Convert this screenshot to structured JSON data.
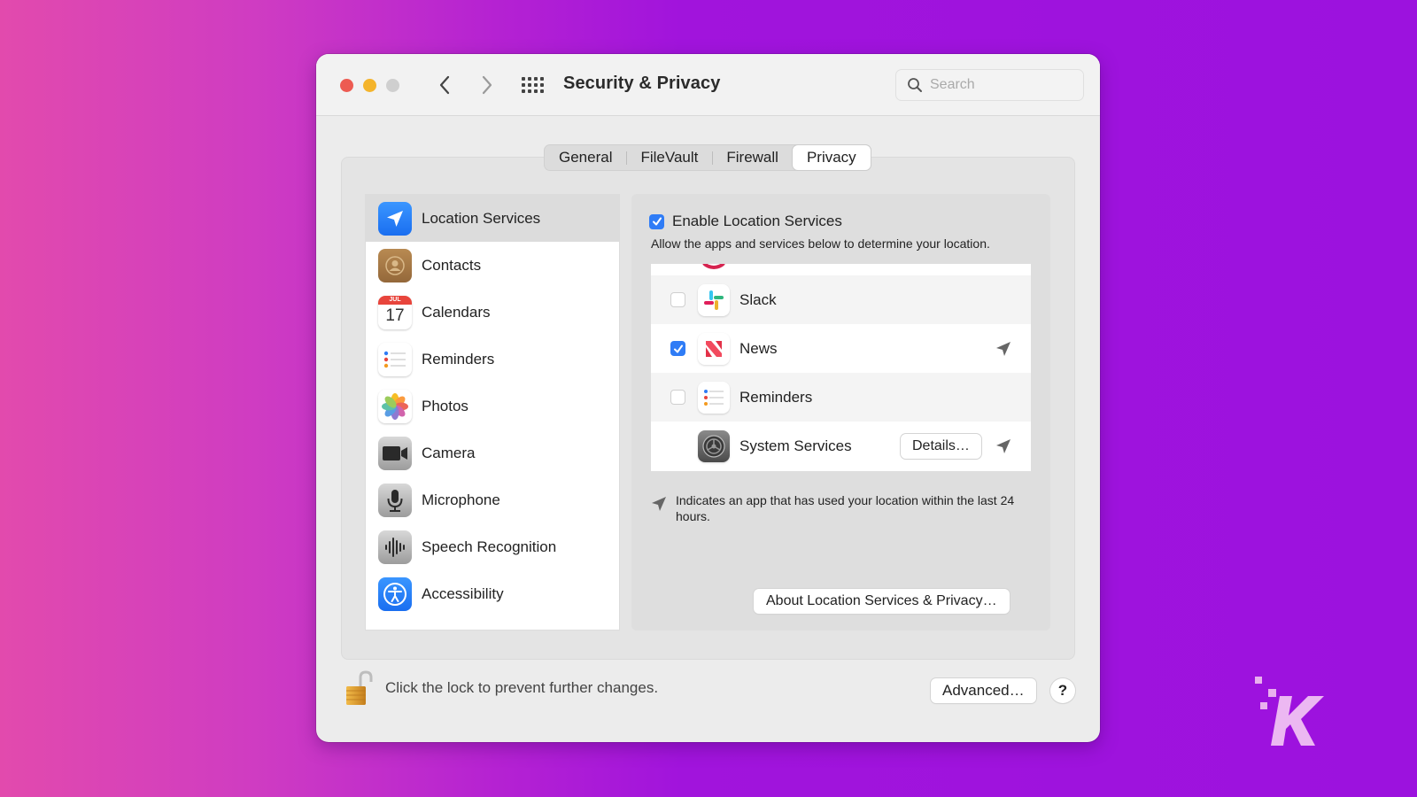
{
  "window": {
    "title": "Security & Privacy",
    "search": {
      "placeholder": "Search",
      "value": ""
    },
    "icons": {
      "back": "chevron-left-icon",
      "forward": "chevron-right-icon",
      "grid": "grid-icon",
      "search": "search-icon"
    }
  },
  "tabs": [
    {
      "label": "General",
      "active": false
    },
    {
      "label": "FileVault",
      "active": false
    },
    {
      "label": "Firewall",
      "active": false
    },
    {
      "label": "Privacy",
      "active": true
    }
  ],
  "sidebar": {
    "items": [
      {
        "label": "Location Services",
        "icon": "location-arrow-icon",
        "selected": true
      },
      {
        "label": "Contacts",
        "icon": "contacts-icon",
        "selected": false
      },
      {
        "label": "Calendars",
        "icon": "calendar-icon",
        "selected": false,
        "icon_month": "JUL",
        "icon_day": "17"
      },
      {
        "label": "Reminders",
        "icon": "reminders-icon",
        "selected": false
      },
      {
        "label": "Photos",
        "icon": "photos-icon",
        "selected": false
      },
      {
        "label": "Camera",
        "icon": "camera-icon",
        "selected": false
      },
      {
        "label": "Microphone",
        "icon": "microphone-icon",
        "selected": false
      },
      {
        "label": "Speech Recognition",
        "icon": "waveform-icon",
        "selected": false
      },
      {
        "label": "Accessibility",
        "icon": "accessibility-icon",
        "selected": false
      }
    ]
  },
  "location": {
    "enable_label": "Enable Location Services",
    "enabled": true,
    "description": "Allow the apps and services below to determine your location.",
    "apps": [
      {
        "name": "Slack",
        "checked": false,
        "recent_use": false,
        "icon": "slack-icon"
      },
      {
        "name": "News",
        "checked": true,
        "recent_use": true,
        "icon": "news-icon"
      },
      {
        "name": "Reminders",
        "checked": false,
        "recent_use": false,
        "icon": "reminders-icon"
      },
      {
        "name": "System Services",
        "checked": null,
        "recent_use": true,
        "icon": "gear-icon",
        "button": "Details…"
      }
    ],
    "legend": "Indicates an app that has used your location within the last 24 hours.",
    "about_button": "About Location Services & Privacy…"
  },
  "footer": {
    "lock_text": "Click the lock to prevent further changes.",
    "lock_state": "unlocked",
    "advanced_button": "Advanced…",
    "help_button": "?"
  },
  "colors": {
    "accent": "#2f7cf6",
    "close": "#ed5b52",
    "minimize": "#f4b42c",
    "zoom_disabled": "#cfcfcf",
    "background_left": "#e24aad",
    "background_right": "#9c12de"
  }
}
